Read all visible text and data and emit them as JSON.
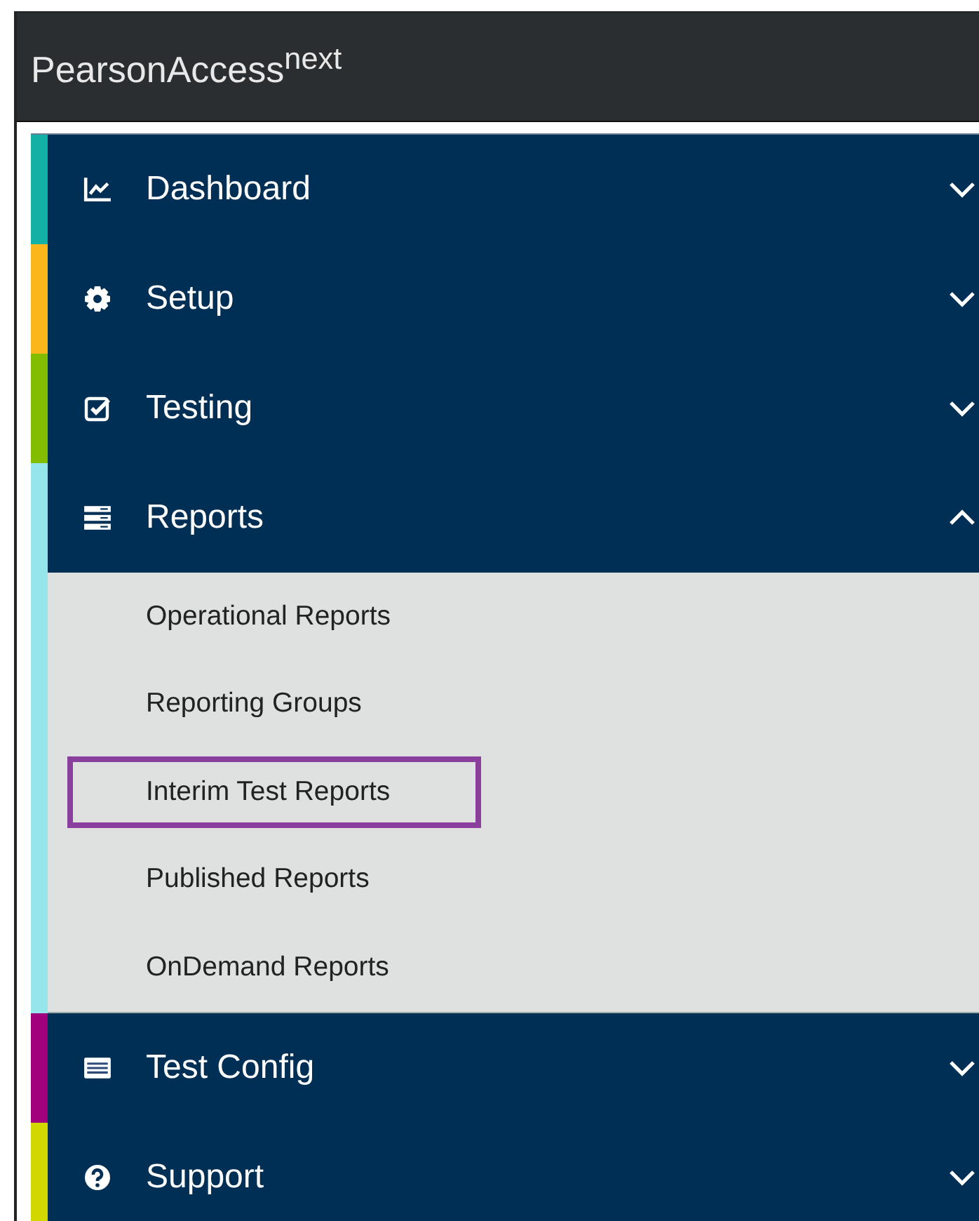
{
  "header": {
    "brand": "PearsonAccess$^{next}$"
  },
  "menu": [
    {
      "label": "Dashboard",
      "color": "#13b0a5",
      "expanded": false
    },
    {
      "label": "Setup",
      "color": "#fbb61c",
      "expanded": false
    },
    {
      "label": "Testing",
      "color": "#84bd00",
      "expanded": false
    },
    {
      "label": "Reports",
      "color": "#96e5ea",
      "expanded": true,
      "children": [
        {
          "label": "Operational Reports",
          "highlighted": false
        },
        {
          "label": "Reporting Groups",
          "highlighted": false
        },
        {
          "label": "Interim Test Reports",
          "highlighted": true
        },
        {
          "label": "Published Reports",
          "highlighted": false
        },
        {
          "label": "OnDemand Reports",
          "highlighted": false
        }
      ]
    },
    {
      "label": "Test Config",
      "color": "#a1007d",
      "expanded": false
    },
    {
      "label": "Support",
      "color": "#d2d700",
      "expanded": false
    }
  ]
}
